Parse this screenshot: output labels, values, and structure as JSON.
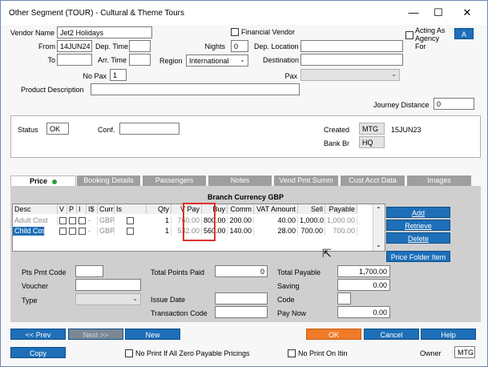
{
  "window": {
    "title": "Other Segment (TOUR) - Cultural & Theme Tours",
    "minimize": "—",
    "maximize": "☐",
    "close": "✕"
  },
  "header": {
    "vendor_name_label": "Vendor Name",
    "vendor_name_value": "Jet2 Holidays",
    "financial_vendor_label": "Financial Vendor",
    "acting_as_agency_label": "Acting As Agency For",
    "acting_as_agency_button": "A",
    "from_label": "From",
    "from_value": "14JUN24",
    "dep_time_label": "Dep. Time",
    "nights_label": "Nights",
    "nights_value": "0",
    "dep_location_label": "Dep. Location",
    "to_label": "To",
    "arr_time_label": "Arr. Time",
    "region_label": "Region",
    "region_value": "International",
    "destination_label": "Destination",
    "no_pax_label": "No Pax",
    "no_pax_value": "1",
    "pax_label": "Pax",
    "product_description_label": "Product Description",
    "journey_distance_label": "Journey Distance",
    "journey_distance_value": "0"
  },
  "status": {
    "status_label": "Status",
    "status_value": "OK",
    "conf_label": "Conf.",
    "created_label": "Created",
    "created_by": "MTG",
    "created_date": "15JUN23",
    "bank_br_label": "Bank Br",
    "bank_br_value": "HQ"
  },
  "tabs": [
    {
      "label": "Price"
    },
    {
      "label": "Booking Details"
    },
    {
      "label": "Passengers"
    },
    {
      "label": "Notes"
    },
    {
      "label": "Vend Pmt Summ"
    },
    {
      "label": "Cust Acct Data"
    },
    {
      "label": "Images"
    }
  ],
  "price": {
    "branch_currency": "Branch Currency GBP",
    "columns": [
      "Desc",
      "V",
      "P",
      "I",
      "I$",
      "Curr",
      "Is Markup",
      "Qty",
      "V Pay",
      "Buy",
      "Comm",
      "VAT Amount",
      "Sell",
      "Payable"
    ],
    "rows": [
      {
        "desc": "Adult Cost",
        "i_dollar": "-",
        "curr": "GBP",
        "qty": "1",
        "vpay": "760.00",
        "buy": "800.00",
        "comm": "200.00",
        "vat": "40.00",
        "sell": "1,000.0",
        "payable": "1,000.00"
      },
      {
        "desc": "Child Cost",
        "i_dollar": "-",
        "curr": "GBP",
        "qty": "1",
        "vpay": "532.00",
        "buy": "560.00",
        "comm": "140.00",
        "vat": "28.00",
        "sell": "700.00",
        "payable": "700.00"
      }
    ],
    "buttons": {
      "add": "Add",
      "retrieve": "Retrieve",
      "delete": "Delete",
      "price_folder_item": "Price Folder Item"
    },
    "pts_pmt_code_label": "Pts Pmt Code",
    "total_points_paid_label": "Total Points Paid",
    "total_points_paid_value": "0",
    "total_payable_label": "Total Payable",
    "total_payable_value": "1,700.00",
    "voucher_label": "Voucher",
    "saving_label": "Saving",
    "saving_value": "0.00",
    "type_label": "Type",
    "issue_date_label": "Issue Date",
    "code_label": "Code",
    "transaction_code_label": "Transaction Code",
    "pay_now_label": "Pay Now",
    "pay_now_value": "0.00"
  },
  "footer": {
    "prev": "<< Prev",
    "next": "Next >>",
    "new": "New",
    "ok": "OK",
    "cancel": "Cancel",
    "help": "Help",
    "copy": "Copy",
    "no_print_zero_label": "No Print If All Zero Payable Pricings",
    "no_print_itin_label": "No Print On Itin",
    "owner_label": "Owner",
    "owner_value": "MTG"
  },
  "icons": {
    "dropdown": "chevron-down-icon",
    "cursor": "mouse-cursor-icon"
  }
}
